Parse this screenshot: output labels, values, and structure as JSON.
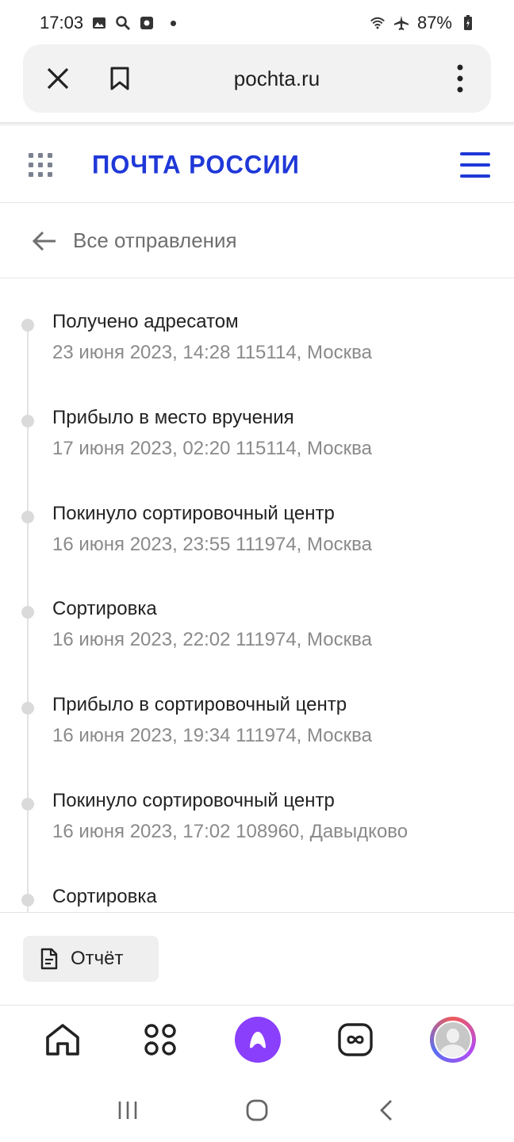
{
  "status_bar": {
    "time": "17:03",
    "battery": "87%"
  },
  "browser": {
    "url": "pochta.ru"
  },
  "site": {
    "logo": "ПОЧТА РОССИИ"
  },
  "back": {
    "label": "Все отправления"
  },
  "events": [
    {
      "title": "Получено адресатом",
      "details": "23 июня 2023, 14:28 115114, Москва"
    },
    {
      "title": "Прибыло в место вручения",
      "details": "17 июня 2023, 02:20 115114, Москва"
    },
    {
      "title": "Покинуло сортировочный центр",
      "details": "16 июня 2023, 23:55 111974, Москва"
    },
    {
      "title": "Сортировка",
      "details": "16 июня 2023, 22:02 111974, Москва"
    },
    {
      "title": "Прибыло в сортировочный центр",
      "details": "16 июня 2023, 19:34 111974, Москва"
    },
    {
      "title": "Покинуло сортировочный центр",
      "details": "16 июня 2023, 17:02 108960, Давыдково"
    },
    {
      "title": "Сортировка",
      "details": ""
    }
  ],
  "report": {
    "label": "Отчёт"
  },
  "colors": {
    "brand": "#1f38d8",
    "alice": "#8a3ffc"
  }
}
